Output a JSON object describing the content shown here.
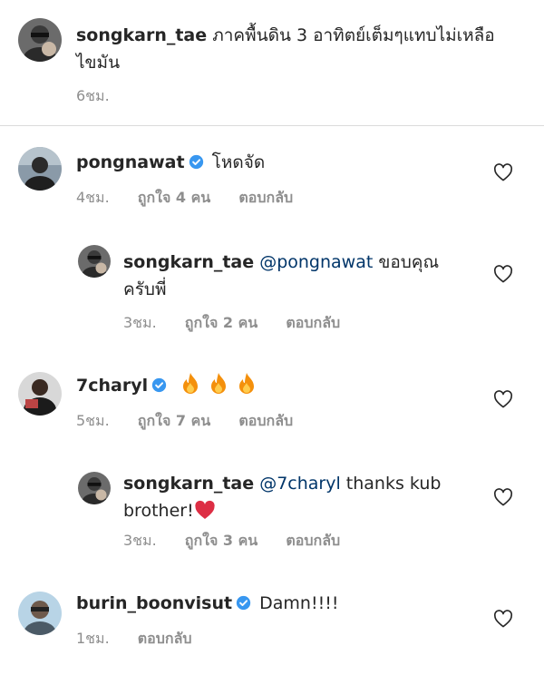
{
  "caption": {
    "username": "songkarn_tae",
    "text": "ภาคพื้นดิน 3 อาทิตย์เต็มๆแทบไม่เหลือไขมัน",
    "time": "6ชม."
  },
  "comments": [
    {
      "username": "pongnawat",
      "verified": true,
      "text": "โหดจัด",
      "time": "4ชม.",
      "likes": "ถูกใจ 4 คน",
      "reply": "ตอบกลับ"
    },
    {
      "username": "songkarn_tae",
      "mention": "@pongnawat",
      "text": "ขอบคุณครับพี่",
      "time": "3ชม.",
      "likes": "ถูกใจ 2 คน",
      "reply": "ตอบกลับ"
    },
    {
      "username": "7charyl",
      "verified": true,
      "text": "",
      "emoji": [
        "fire",
        "fire",
        "fire"
      ],
      "time": "5ชม.",
      "likes": "ถูกใจ 7 คน",
      "reply": "ตอบกลับ"
    },
    {
      "username": "songkarn_tae",
      "mention": "@7charyl",
      "text": "thanks kub brother!",
      "emoji": [
        "red-heart"
      ],
      "time": "3ชม.",
      "likes": "ถูกใจ 3 คน",
      "reply": "ตอบกลับ"
    },
    {
      "username": "burin_boonvisut",
      "verified": true,
      "text": "Damn!!!!",
      "time": "1ชม.",
      "reply": "ตอบกลับ"
    }
  ],
  "icons": {
    "like": "heart-outline-icon",
    "verified": "verified-badge-icon"
  },
  "colors": {
    "verified": "#3897f0",
    "mention": "#003569",
    "meta": "#8e8e8e",
    "divider": "#dbdbdb"
  }
}
